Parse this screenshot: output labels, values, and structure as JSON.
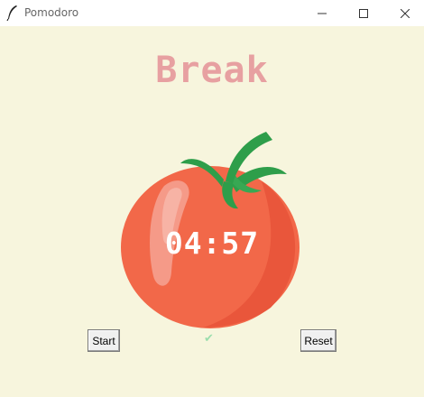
{
  "window": {
    "title": "Pomodoro"
  },
  "heading": {
    "text": "Break",
    "color": "#e7a0a1"
  },
  "timer": {
    "text": "04:57"
  },
  "buttons": {
    "start_label": "Start",
    "reset_label": "Reset"
  },
  "checkmarks": {
    "text": "✔",
    "color": "#9bdeac"
  },
  "icons": {
    "app": "feather-icon",
    "minimize": "minimize-icon",
    "maximize": "maximize-icon",
    "close": "close-icon",
    "tomato": "tomato-image"
  },
  "colors": {
    "background": "#f7f5dd",
    "tomato": "#f26849",
    "leaf": "#2e9e4a"
  }
}
